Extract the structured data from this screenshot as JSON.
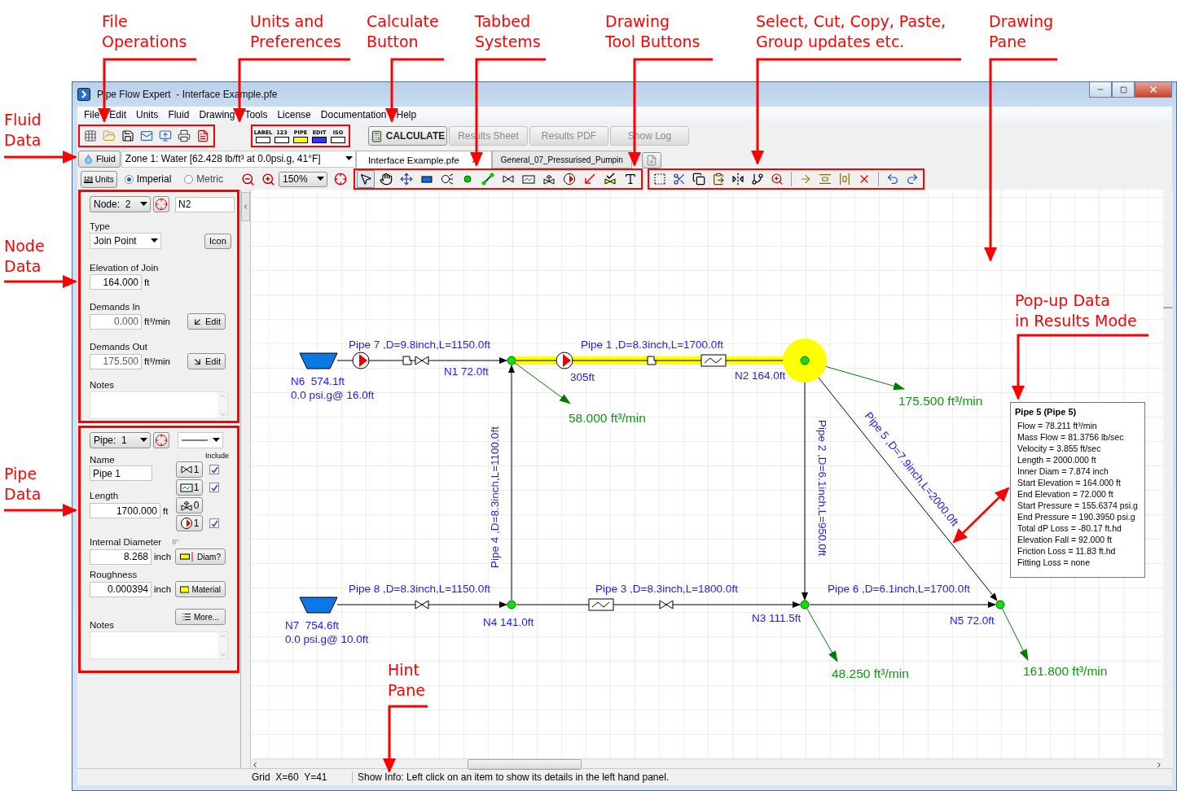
{
  "window": {
    "title": "Pipe Flow Expert  - Interface Example.pfe"
  },
  "menu": [
    "File",
    "Edit",
    "Units",
    "Fluid",
    "Drawing",
    "Tools",
    "License",
    "Documentation",
    "Help"
  ],
  "file_tools": [
    {
      "kind": "new"
    },
    {
      "kind": "open"
    },
    {
      "kind": "save"
    },
    {
      "kind": "email"
    },
    {
      "kind": "export"
    },
    {
      "kind": "print"
    },
    {
      "kind": "pdf"
    }
  ],
  "units_tools": [
    "LABEL",
    "123",
    "PIPE",
    "EDIT",
    "ISO"
  ],
  "actions": [
    {
      "label": "CALCULATE",
      "disabled": false
    },
    {
      "label": "Results Sheet",
      "disabled": true
    },
    {
      "label": "Results PDF",
      "disabled": true
    },
    {
      "label": "Show Log",
      "disabled": true
    }
  ],
  "fluid": {
    "button": "Fluid",
    "zone": "Zone 1: Water [62.428 lb/ft³ at 0.0psi.g, 41°F]"
  },
  "units": {
    "button": "Units",
    "icon_text": "123",
    "systems": [
      {
        "label": "Imperial",
        "selected": true
      },
      {
        "label": "Metric",
        "selected": false
      }
    ]
  },
  "zoom": "150%",
  "tabs": [
    {
      "label": "Interface Example.pfe",
      "selected": true
    },
    {
      "label": "General_07_Pressurised_Pumpin",
      "selected": false
    }
  ],
  "drawing_tools": [
    {
      "kind": "pointer",
      "selected": true
    },
    {
      "kind": "hand",
      "selected": false
    },
    {
      "kind": "move",
      "selected": false
    },
    {
      "kind": "tank",
      "selected": false
    },
    {
      "kind": "pressure",
      "selected": false
    },
    {
      "kind": "join",
      "selected": false
    },
    {
      "kind": "pipe",
      "selected": false
    },
    {
      "kind": "valve",
      "selected": false
    },
    {
      "kind": "filter",
      "selected": false
    },
    {
      "kind": "control-valve",
      "selected": false
    },
    {
      "kind": "pump",
      "selected": false
    },
    {
      "kind": "demand",
      "selected": false
    },
    {
      "kind": "check",
      "selected": false
    },
    {
      "kind": "text",
      "selected": false
    }
  ],
  "edit_tools": [
    {
      "kind": "select"
    },
    {
      "kind": "cut"
    },
    {
      "kind": "copy"
    },
    {
      "kind": "paste"
    },
    {
      "kind": "flip"
    },
    {
      "kind": "branch"
    },
    {
      "kind": "zoom"
    },
    {
      "kind": "separator"
    },
    {
      "kind": "node-move"
    },
    {
      "kind": "align"
    },
    {
      "kind": "distribute"
    },
    {
      "kind": "delete"
    },
    {
      "kind": "separator"
    },
    {
      "kind": "undo"
    },
    {
      "kind": "redo"
    }
  ],
  "node": {
    "selector": "Node:  2",
    "name": "N2",
    "type_label": "Type",
    "type": "Join Point",
    "icon_button": "Icon",
    "fields": [
      {
        "kind": "elevation",
        "label": "Elevation of Join",
        "value": "164.000",
        "unit": "ft",
        "readonly": false
      },
      {
        "kind": "demand-in",
        "label": "Demands In",
        "value": "0.000",
        "unit": "ft³/min",
        "readonly": true,
        "button": "Edit"
      },
      {
        "kind": "demand-out",
        "label": "Demands Out",
        "value": "175.500",
        "unit": "ft³/min",
        "readonly": true,
        "button": "Edit"
      }
    ],
    "notes_label": "Notes"
  },
  "pipe": {
    "selector": "Pipe:  1",
    "name_label": "Name",
    "name": "Pipe 1",
    "include_label": "Include",
    "fittings": [
      {
        "kind": "valve",
        "count": "1",
        "included": true
      },
      {
        "kind": "filter",
        "count": "1",
        "included": true
      },
      {
        "kind": "control-valve",
        "count": "0"
      },
      {
        "kind": "pump",
        "count": "1",
        "included": true
      }
    ],
    "length": {
      "label": "Length",
      "value": "1700.000",
      "unit": "ft"
    },
    "diameter": {
      "label": "Internal Diameter",
      "nominal": "8\"",
      "value": "8.268",
      "unit": "inch",
      "button": "Diam?"
    },
    "roughness": {
      "label": "Roughness",
      "value": "0.000394",
      "unit": "inch",
      "button": "Material"
    },
    "more_button": "More...",
    "notes_label": "Notes"
  },
  "diagram": {
    "nodes": [
      {
        "kind": "tank",
        "label": "N6  574.1ft",
        "sub": "0.0 psi.g@ 16.0ft",
        "selected": false
      },
      {
        "kind": "join",
        "label": "N1 72.0ft",
        "selected": false
      },
      {
        "kind": "join",
        "label": "N2 164.0ft",
        "selected": true
      },
      {
        "kind": "tank",
        "label": "N7  754.6ft",
        "sub": "0.0 psi.g@ 10.0ft",
        "selected": false
      },
      {
        "kind": "join",
        "label": "N4 141.0ft",
        "selected": false
      },
      {
        "kind": "join",
        "label": "N3 111.5ft",
        "selected": false
      },
      {
        "kind": "join",
        "label": "N5 72.0ft",
        "selected": false
      }
    ],
    "pipes": [
      {
        "label": "Pipe 7 ,D=9.8inch,L=1150.0ft",
        "selected": false
      },
      {
        "label": "Pipe 1 ,D=8.3inch,L=1700.0ft",
        "selected": true,
        "pump_head": "305ft"
      },
      {
        "label": "Pipe 4 ,D=8.3inch,L=1100.0ft",
        "selected": false
      },
      {
        "label": "Pipe 2 ,D=6.1inch,L=950.0ft",
        "selected": false
      },
      {
        "label": "Pipe 5 ,D=7.9inch,L=2000.0ft",
        "selected": false
      },
      {
        "label": "Pipe 8 ,D=8.3inch,L=1150.0ft",
        "selected": false
      },
      {
        "label": "Pipe 3 ,D=8.3inch,L=1800.0ft",
        "selected": false
      },
      {
        "label": "Pipe 6 ,D=6.1inch,L=1700.0ft",
        "selected": false
      }
    ],
    "demands": [
      "58.000 ft³/min",
      "175.500 ft³/min",
      "48.250 ft³/min",
      "161.800 ft³/min"
    ]
  },
  "popup": {
    "title": "Pipe 5 (Pipe 5)",
    "lines": [
      "Flow = 78.211 ft³/min",
      "Mass Flow = 81.3756 lb/sec",
      "Velocity = 3.855 ft/sec",
      "Length = 2000.000 ft",
      "Inner Diam = 7.874 inch",
      "Start Elevation = 164.000 ft",
      "End Elevation = 72.000 ft",
      "Start Pressure = 155.6374 psi.g",
      "End Pressure = 190.3950 psi.g",
      "Total dP Loss = -80.17 ft.hd",
      "Elevation Fall = 92.000 ft",
      "Friction Loss = 11.83 ft.hd",
      "Fitting Loss = none"
    ]
  },
  "status": {
    "grid": "Grid  X=60  Y=41",
    "hint": "Show Info: Left click on an item to show its details in the left hand panel."
  },
  "annotations": [
    {
      "lines": [
        "File",
        "Operations"
      ]
    },
    {
      "lines": [
        "Units and",
        "Preferences"
      ]
    },
    {
      "lines": [
        "Calculate",
        "Button"
      ]
    },
    {
      "lines": [
        "Tabbed",
        "Systems"
      ]
    },
    {
      "lines": [
        "Drawing",
        "Tool Buttons"
      ]
    },
    {
      "lines": [
        "Select, Cut, Copy, Paste,",
        "Group updates etc."
      ]
    },
    {
      "lines": [
        "Drawing",
        "Pane"
      ]
    },
    {
      "lines": [
        "Fluid",
        "Data"
      ]
    },
    {
      "lines": [
        "Node",
        "Data"
      ]
    },
    {
      "lines": [
        "Pipe",
        "Data"
      ]
    },
    {
      "lines": [
        "Pop-up Data",
        "in Results Mode"
      ]
    },
    {
      "lines": [
        "Hint",
        "Pane"
      ]
    }
  ]
}
